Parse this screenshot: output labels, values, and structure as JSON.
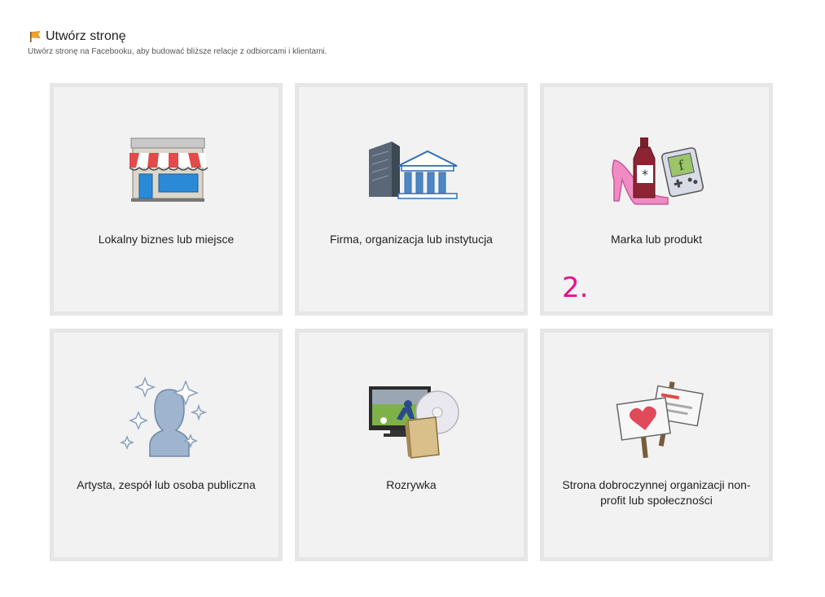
{
  "header": {
    "title": "Utwórz stronę",
    "subtitle": "Utwórz stronę na Facebooku, aby budować bliższe relacje z odbiorcami i klientami."
  },
  "categories": [
    {
      "label": "Lokalny biznes lub miejsce",
      "icon": "storefront-icon"
    },
    {
      "label": "Firma, organizacja lub instytucja",
      "icon": "company-buildings-icon"
    },
    {
      "label": "Marka lub produkt",
      "icon": "brand-products-icon"
    },
    {
      "label": "Artysta, zespół lub osoba publiczna",
      "icon": "public-figure-icon"
    },
    {
      "label": "Rozrywka",
      "icon": "entertainment-icon"
    },
    {
      "label": "Strona dobroczynnej organizacji non-profit lub społeczności",
      "icon": "protest-signs-icon"
    }
  ],
  "annotation": "2."
}
